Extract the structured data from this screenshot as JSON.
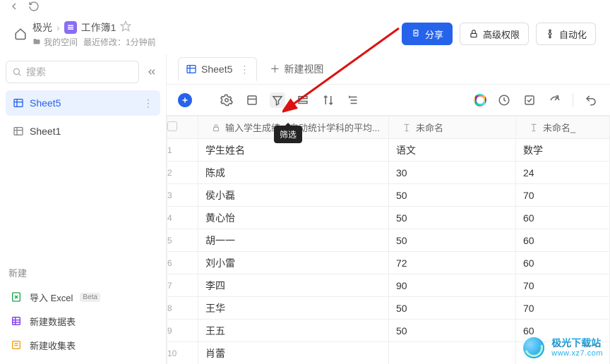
{
  "breadcrumb": {
    "parent": "极光",
    "title": "工作簿1"
  },
  "sub": {
    "space_label": "我的空间",
    "last_mod_label": "最近修改：",
    "last_mod_value": "1分钟前"
  },
  "header_buttons": {
    "share": "分享",
    "perm": "高级权限",
    "auto": "自动化"
  },
  "search_placeholder": "搜索",
  "sheets": [
    {
      "name": "Sheet5",
      "active": true
    },
    {
      "name": "Sheet1",
      "active": false
    }
  ],
  "side_new": {
    "title": "新建",
    "import_excel": "导入 Excel",
    "beta": "Beta",
    "new_db": "新建数据表",
    "new_form": "新建收集表"
  },
  "tabs": {
    "active": "Sheet5",
    "new_view": "新建视图"
  },
  "tooltip_filter": "筛选",
  "columns": {
    "a_hint": "输入学生成绩，自动统计学科的平均...",
    "b": "未命名",
    "c": "未命名_"
  },
  "chart_data": {
    "type": "table",
    "columns": [
      "",
      "语文",
      "数学"
    ],
    "rows": [
      [
        "学生姓名",
        "语文",
        "数学"
      ],
      [
        "陈成",
        "30",
        "24"
      ],
      [
        "侯小磊",
        "50",
        "70"
      ],
      [
        "黄心怡",
        "50",
        "60"
      ],
      [
        "胡一一",
        "50",
        "60"
      ],
      [
        "刘小雷",
        "72",
        "60"
      ],
      [
        "李四",
        "90",
        "70"
      ],
      [
        "王华",
        "50",
        "70"
      ],
      [
        "王五",
        "50",
        "60"
      ],
      [
        "肖蕾",
        "",
        ""
      ]
    ]
  },
  "watermark": {
    "line1": "极光下载站",
    "line2": "www.xz7.com"
  }
}
